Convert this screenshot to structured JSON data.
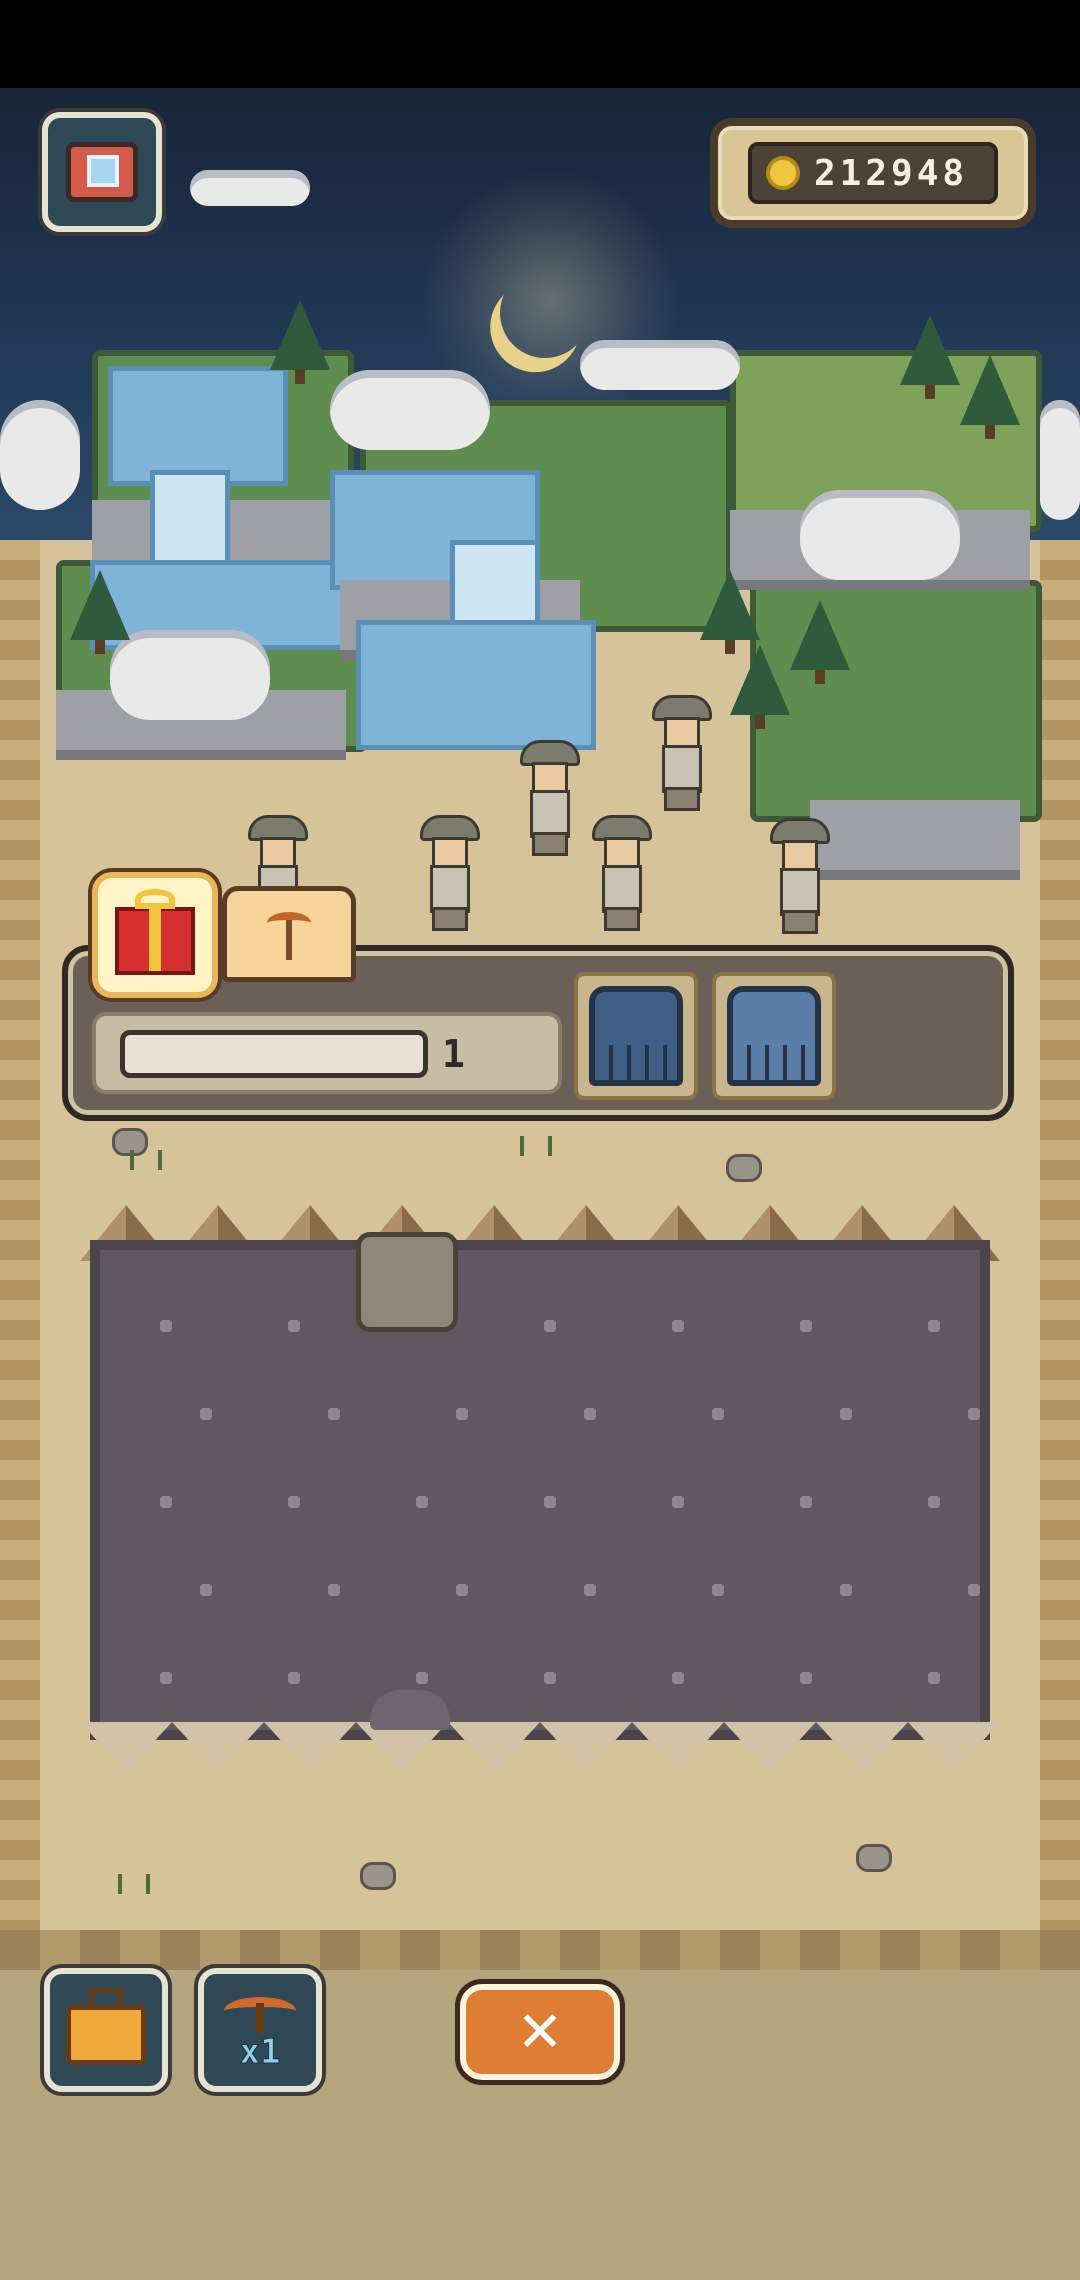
{
  "hud": {
    "coins": "212948"
  },
  "dig_panel": {
    "progress_fraction": 0.0,
    "count": "1",
    "carts": [
      "cart-closed-icon",
      "cart-open-icon"
    ]
  },
  "toolbar": {
    "pickaxe_count": "x1",
    "close_label": "✕"
  },
  "icons": {
    "camera": "camera-icon",
    "coin": "coin-icon",
    "gift": "gift-icon",
    "worker": "worker-pickaxe-icon",
    "toolbox": "toolbox-icon",
    "pickaxe": "pickaxe-icon"
  },
  "colors": {
    "accent": "#e07d35",
    "sky": "#1f3552",
    "ground": "#d6c39a",
    "pit": "#605860"
  }
}
